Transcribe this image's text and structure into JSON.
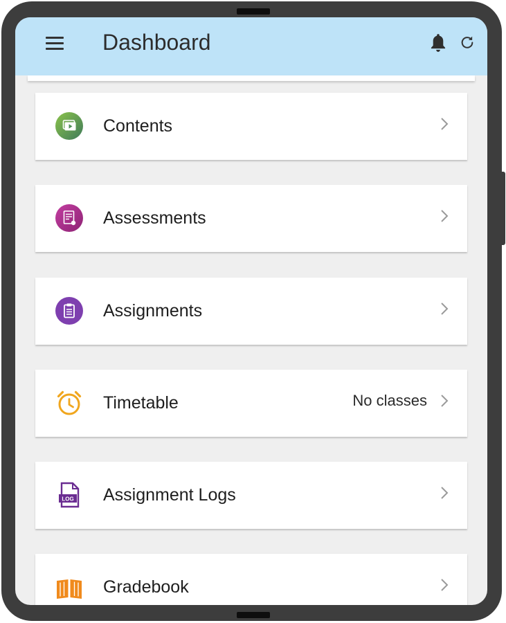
{
  "header": {
    "title": "Dashboard"
  },
  "icons": {
    "menu": "menu-icon",
    "notifications": "bell-icon",
    "refresh": "refresh-icon",
    "chevron": "chevron-right-icon"
  },
  "colors": {
    "appbar": "#bee3f8",
    "background": "#efefef",
    "card": "#ffffff",
    "contents_icon": "#6aa84f",
    "assessments_icon": "#b0308f",
    "assignments_icon": "#7e3faf",
    "timetable_icon": "#f0a61e",
    "logs_icon": "#6a2c91",
    "gradebook_icon": "#f08a1c"
  },
  "cards": [
    {
      "label": "Contents",
      "icon": "video-content-icon",
      "extra": ""
    },
    {
      "label": "Assessments",
      "icon": "assessment-sheet-icon",
      "extra": ""
    },
    {
      "label": "Assignments",
      "icon": "clipboard-icon",
      "extra": ""
    },
    {
      "label": "Timetable",
      "icon": "alarm-clock-icon",
      "extra": "No classes"
    },
    {
      "label": "Assignment Logs",
      "icon": "log-file-icon",
      "extra": ""
    },
    {
      "label": "Gradebook",
      "icon": "open-book-icon",
      "extra": ""
    }
  ]
}
